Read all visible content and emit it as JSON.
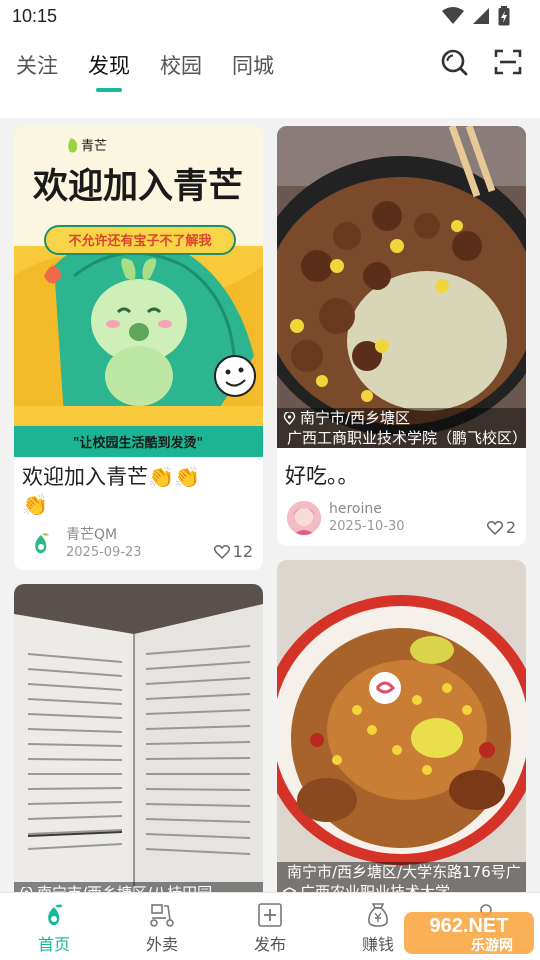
{
  "status": {
    "time": "10:15"
  },
  "header": {
    "tabs": [
      {
        "label": "关注",
        "active": false
      },
      {
        "label": "发现",
        "active": true
      },
      {
        "label": "校园",
        "active": false
      },
      {
        "label": "同城",
        "active": false
      }
    ]
  },
  "feed": {
    "cards": [
      {
        "image_title": "欢迎加入青芒",
        "image_logo": "青芒",
        "image_bubble": "不允许还有宝子不了解我",
        "image_footer": "\"让校园生活酷到发烫\"",
        "title": "欢迎加入青芒👏👏\n👏",
        "author": "青芒QM",
        "date": "2025-09-23",
        "likes": "12"
      },
      {
        "location_lines": [
          "南宁市/西乡塘区",
          "广西工商职业技术学院（鹏飞校区）"
        ],
        "title": "好吃。。",
        "author": "heroine",
        "date": "2025-10-30",
        "likes": "2"
      },
      {
        "location_lines": [
          "南宁市/西乡塘区/八桂田园"
        ]
      },
      {
        "location_lines": [
          "南宁市/西乡塘区/大学东路176号广",
          "广西农业职业技术大学"
        ]
      }
    ]
  },
  "bottomnav": {
    "items": [
      {
        "label": "首页",
        "active": true
      },
      {
        "label": "外卖",
        "active": false
      },
      {
        "label": "发布",
        "active": false
      },
      {
        "label": "赚钱",
        "active": false
      }
    ]
  },
  "watermark": {
    "text": "962.NET",
    "subtext": "乐游网"
  },
  "colors": {
    "accent": "#19b89a"
  }
}
